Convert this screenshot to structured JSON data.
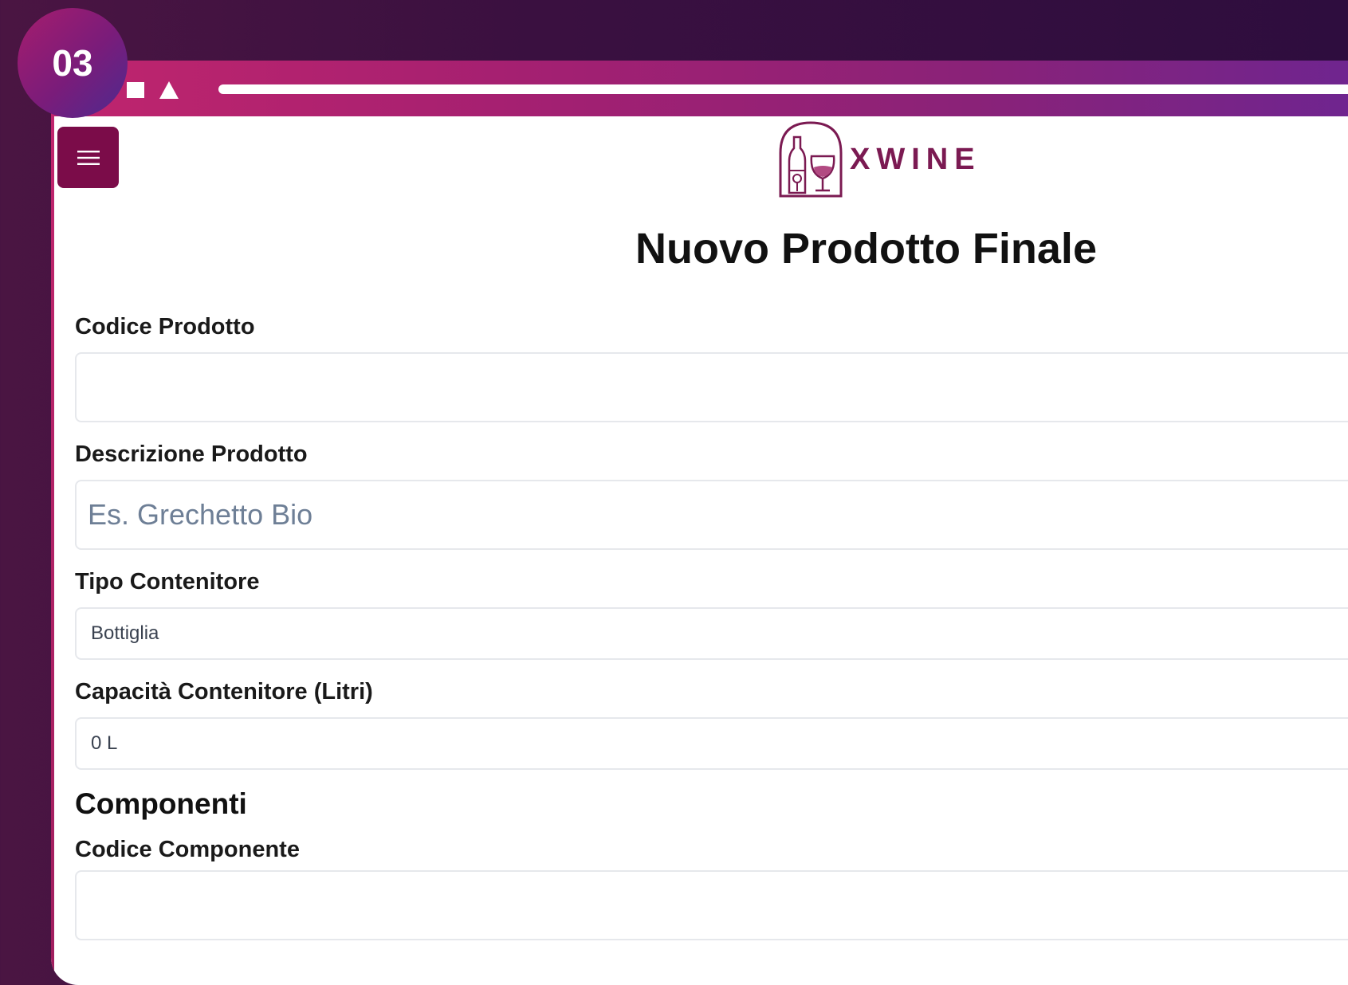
{
  "step_badge": "03",
  "logo": {
    "text": "XWINE",
    "icon": "wine-bottle-glass-logo"
  },
  "menu": {
    "icon": "hamburger-menu-icon"
  },
  "page_title": "Nuovo Prodotto Finale",
  "form": {
    "codice_prodotto": {
      "label": "Codice Prodotto",
      "value": ""
    },
    "descrizione_prodotto": {
      "label": "Descrizione Prodotto",
      "placeholder": "Es. Grechetto Bio"
    },
    "tipo_contenitore": {
      "label": "Tipo Contenitore",
      "value": "Bottiglia"
    },
    "capacita_contenitore": {
      "label": "Capacità Contenitore (Litri)",
      "value": "0 L"
    }
  },
  "componenti": {
    "heading": "Componenti",
    "codice_componente": {
      "label": "Codice Componente",
      "value": ""
    }
  },
  "colors": {
    "brand": "#7b0c49",
    "titlebar_start": "#c0256d",
    "titlebar_end": "#6e2590",
    "background": "#3a1040"
  }
}
